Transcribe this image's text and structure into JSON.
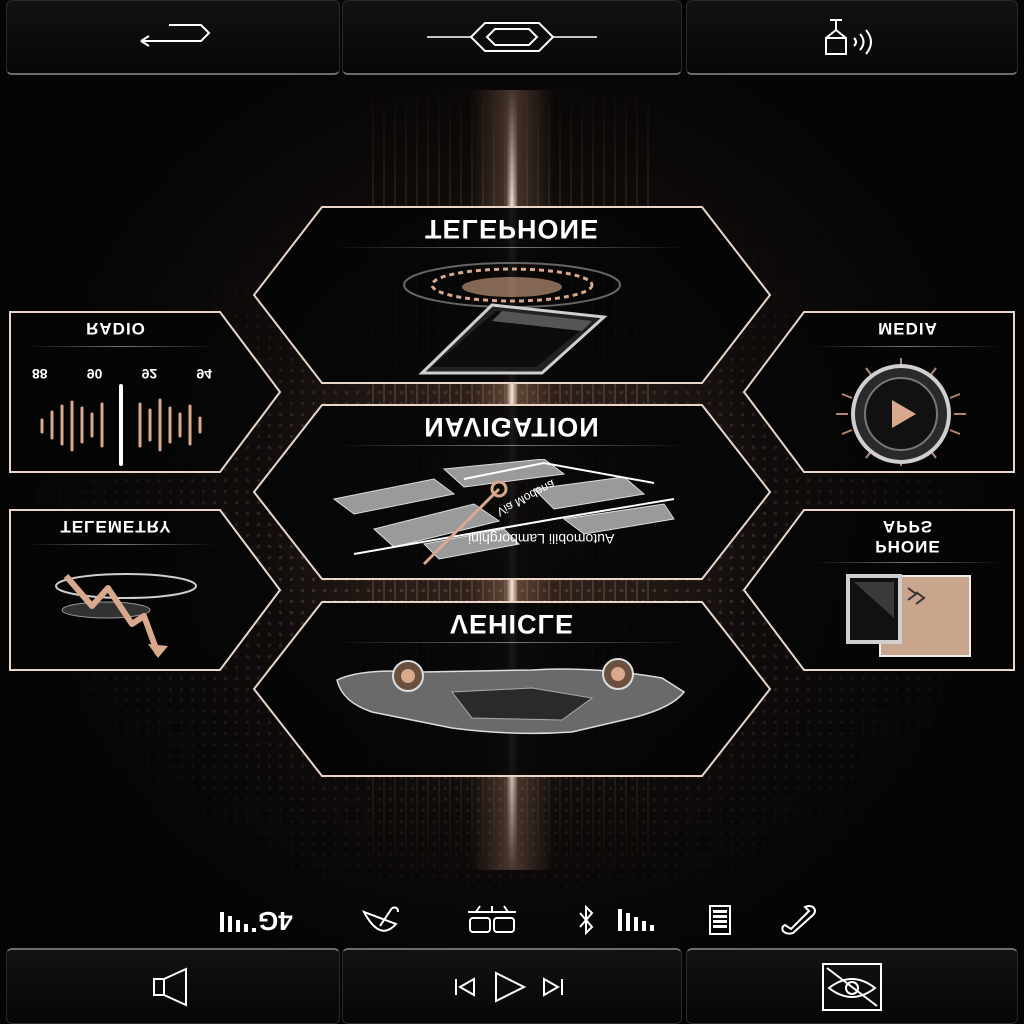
{
  "top_bar": {
    "back": "back-arrow-icon",
    "home": "home-hexagon-icon",
    "voice": "voice-command-icon"
  },
  "tiles": {
    "telephone": "TELEPHONE",
    "navigation": "NAVIGATION",
    "vehicle": "VEHICLE",
    "radio": "RADIO",
    "telemetry": "TELEMETRY",
    "media": "MEDIA",
    "phone_apps_line1": "PHONE",
    "phone_apps_line2": "APPS"
  },
  "radio_freqs": [
    "88",
    "90",
    "92",
    "94"
  ],
  "nav_map": {
    "street1": "Via Modena",
    "street2": "Automobili Lamborghini"
  },
  "status_bar": {
    "network": "4G",
    "signal_icon": "signal-bars-icon",
    "weather_icon": "umbrella-icon",
    "usb_icon": "usb-dual-icon",
    "bluetooth_icon": "bluetooth-icon",
    "battery_icon": "battery-icon",
    "phone_icon": "phone-handset-icon"
  },
  "bottom_bar": {
    "volume": "speaker-icon",
    "media_controls": "play-controls-icon",
    "display": "display-toggle-icon"
  },
  "colors": {
    "accent": "#d8a98c",
    "frame": "#e9d6c8",
    "background": "#000000"
  }
}
